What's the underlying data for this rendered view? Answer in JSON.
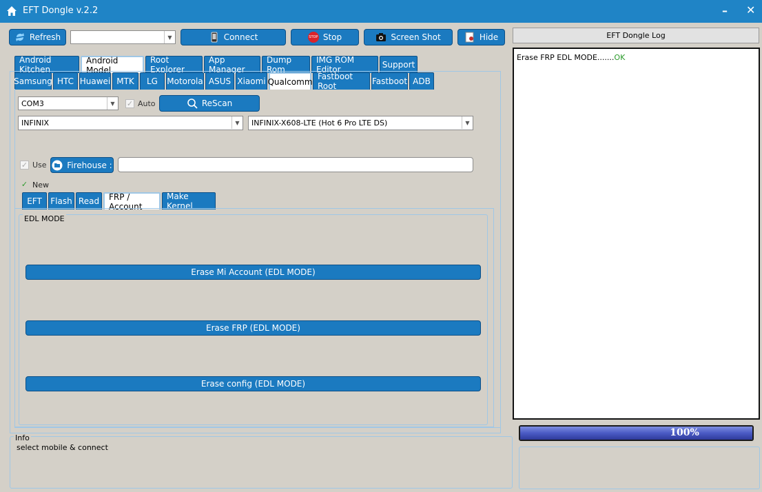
{
  "window": {
    "title": "EFT Dongle  v.2.2"
  },
  "toolbar": {
    "refresh": "Refresh",
    "port_combo": "",
    "connect": "Connect",
    "stop": "Stop",
    "stop_badge": "STOP",
    "screenshot": "Screen Shot",
    "hide": "Hide"
  },
  "main_tabs": [
    "Android Kitchen",
    "Android Model",
    "Root Explorer",
    "App Manager",
    "Dump Rom",
    "IMG ROM Editor",
    "Support"
  ],
  "brand_tabs": [
    "Samsung",
    "HTC",
    "Huawei",
    "MTK",
    "LG",
    "Motorola",
    "ASUS",
    "Xiaomi",
    "Qualcomm",
    "Fastboot Root",
    "Fastboot",
    "ADB"
  ],
  "port": {
    "value": "COM3",
    "auto_label": "Auto",
    "rescan": "ReScan"
  },
  "brand": {
    "value": "INFINIX"
  },
  "model": {
    "value": "INFINIX-X608-LTE (Hot 6 Pro LTE DS)"
  },
  "firehouse": {
    "use_label": "Use",
    "button": "Firehouse :",
    "path": ""
  },
  "new_label": "New",
  "sub_tabs": [
    "EFT",
    "Flash",
    "Read",
    "FRP / Account",
    "Make Kernel"
  ],
  "edl": {
    "group_label": "EDL MODE",
    "buttons": [
      "Erase Mi Account (EDL MODE)",
      "Erase FRP (EDL MODE)",
      "Erase config (EDL MODE)"
    ]
  },
  "info": {
    "label": "Info",
    "text": "select mobile & connect"
  },
  "log": {
    "header": "EFT Dongle Log",
    "line_text": "Erase FRP EDL MODE.......",
    "line_status": "OK",
    "status_color": "#2a9a2a"
  },
  "progress": {
    "value": 1.0,
    "label": "100%"
  }
}
